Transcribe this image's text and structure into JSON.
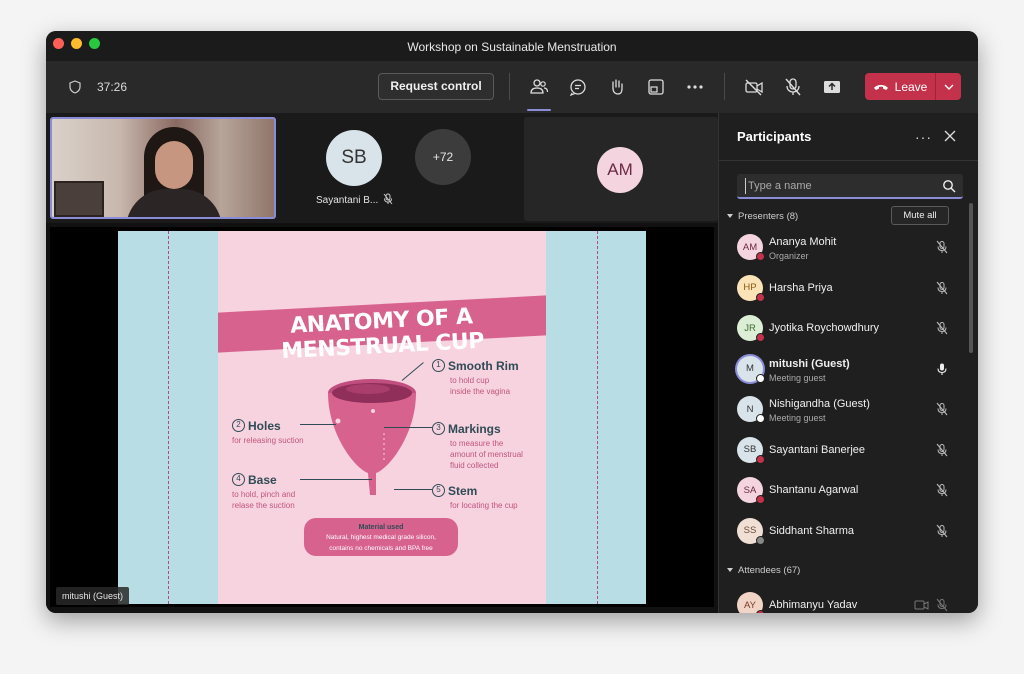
{
  "window": {
    "title": "Workshop on Sustainable Menstruation"
  },
  "toolbar": {
    "timer": "37:26",
    "request_control_label": "Request control",
    "leave_label": "Leave",
    "icons": [
      "shield-icon",
      "people-icon",
      "chat-icon",
      "raise-hand-icon",
      "view-icon",
      "more-icon",
      "camera-off-icon",
      "mic-off-icon",
      "share-icon"
    ]
  },
  "thumbnails": {
    "sb_initials": "SB",
    "sb_name": "Sayantani B...",
    "overflow_count": "+72",
    "am_initials": "AM"
  },
  "slide": {
    "banner": "ANATOMY OF A MENSTRUAL CUP",
    "labels": [
      {
        "num": "1",
        "title": "Smooth Rim",
        "desc1": "to hold cup",
        "desc2": "inside the vagina",
        "desc3": ""
      },
      {
        "num": "2",
        "title": "Holes",
        "desc1": "for releasing suction",
        "desc2": "",
        "desc3": ""
      },
      {
        "num": "3",
        "title": "Markings",
        "desc1": "to measure the",
        "desc2": "amount of menstrual",
        "desc3": "fluid collected"
      },
      {
        "num": "4",
        "title": "Base",
        "desc1": "to hold, pinch and",
        "desc2": "relase the suction",
        "desc3": ""
      },
      {
        "num": "5",
        "title": "Stem",
        "desc1": "for locating the cup",
        "desc2": "",
        "desc3": ""
      }
    ],
    "material_title": "Material used",
    "material_line1": "Natural, highest medical grade silicon,",
    "material_line2": "contains no chemicals and BPA free"
  },
  "stage_name": "mitushi (Guest)",
  "panel": {
    "title": "Participants",
    "search_placeholder": "Type a name",
    "presenters_header": "Presenters (8)",
    "mute_all_label": "Mute all",
    "attendees_header": "Attendees (67)",
    "presenters": [
      {
        "initials": "AM",
        "name": "Ananya Mohit",
        "sub": "Organizer",
        "bg": "#f3d4df",
        "fg": "#6b2b44",
        "dot": "red",
        "mic": "off"
      },
      {
        "initials": "HP",
        "name": "Harsha Priya",
        "sub": "",
        "bg": "#fbe3b8",
        "fg": "#8a5a12",
        "dot": "red",
        "mic": "off"
      },
      {
        "initials": "JR",
        "name": "Jyotika Roychowdhury",
        "sub": "",
        "bg": "#dcefd6",
        "fg": "#3d6b2f",
        "dot": "red",
        "mic": "off"
      },
      {
        "initials": "M",
        "name": "mitushi (Guest)",
        "sub": "Meeting guest",
        "bg": "#d8e3ea",
        "fg": "#333333",
        "dot": "white",
        "mic": "on"
      },
      {
        "initials": "N",
        "name": "Nishigandha (Guest)",
        "sub": "Meeting guest",
        "bg": "#d8e3ea",
        "fg": "#333333",
        "dot": "white",
        "mic": "off"
      },
      {
        "initials": "SB",
        "name": "Sayantani Banerjee",
        "sub": "",
        "bg": "#d8e3ea",
        "fg": "#333333",
        "dot": "red",
        "mic": "off"
      },
      {
        "initials": "SA",
        "name": "Shantanu Agarwal",
        "sub": "",
        "bg": "#f3d4df",
        "fg": "#6b2b44",
        "dot": "red",
        "mic": "off"
      },
      {
        "initials": "SS",
        "name": "Siddhant Sharma",
        "sub": "",
        "bg": "#f0dfd4",
        "fg": "#6b4a38",
        "dot": "grey",
        "mic": "off"
      }
    ],
    "attendees": [
      {
        "initials": "AY",
        "name": "Abhimanyu Yadav",
        "bg": "#f0d4c6",
        "fg": "#7a3b22"
      }
    ]
  },
  "colors": {
    "accent": "#8b8cd8",
    "leave": "#c4314b",
    "banner": "#d7628e",
    "slide_teal": "#b8dde4",
    "slide_pink": "#f7d3df"
  }
}
